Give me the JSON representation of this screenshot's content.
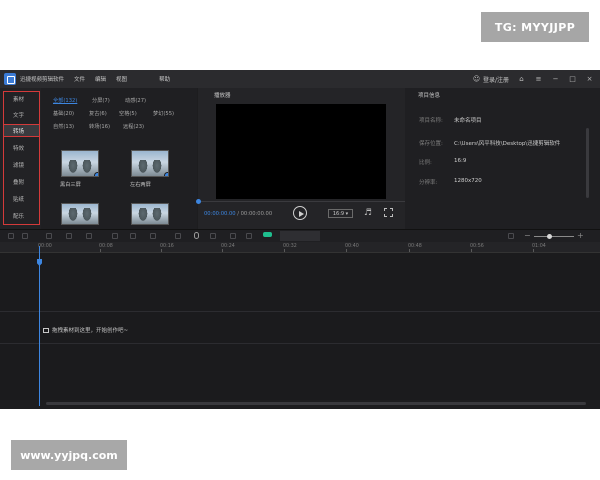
{
  "watermarks": {
    "top": "TG: MYYJJPP",
    "bottom": "www.yyjpq.com"
  },
  "titlebar": {
    "app_name": "迅捷视频剪辑软件",
    "menus": [
      "文件",
      "编辑",
      "视图"
    ],
    "help": "帮助",
    "account": "登录/注册"
  },
  "sidebar": {
    "items": [
      "素材",
      "文字",
      "转场",
      "特效",
      "滤镜",
      "叠附",
      "贴纸",
      "配乐"
    ],
    "active_index": 2
  },
  "assets": {
    "filters_row1": [
      "全部(132)",
      "分屏(7)",
      "动感(27)"
    ],
    "filters_row2": [
      "基础(20)",
      "复古(6)",
      "空格(5)",
      "梦幻(55)"
    ],
    "filters_row3": [
      "自然(13)",
      "转场(16)",
      "远程(23)"
    ],
    "thumbs": [
      "黑白三屏",
      "左右两屏",
      "",
      ""
    ]
  },
  "player": {
    "title": "播放器",
    "time_current": "00:00:00.00",
    "time_total": " / 00:00:00.00",
    "ratio": "16:9"
  },
  "info": {
    "title": "项目信息",
    "rows": [
      {
        "label": "项目名称:",
        "value": "未命名项目"
      },
      {
        "label": "保存位置:",
        "value": "C:\\Users\\风平科技\\Desktop\\迅捷剪辑软件"
      },
      {
        "label": "比例:",
        "value": "16:9"
      },
      {
        "label": "分辨率:",
        "value": "1280x720"
      }
    ]
  },
  "ruler": {
    "ticks": [
      "00:00",
      "00:08",
      "00:16",
      "00:24",
      "00:32",
      "00:40",
      "00:48",
      "00:56",
      "01:04"
    ]
  },
  "timeline": {
    "hint": "拖拽素材到这里，开始创作吧~"
  },
  "colors": {
    "accent": "#3d86e0",
    "highlight_box": "#d43a3a",
    "toggle": "#1fbf8f"
  }
}
